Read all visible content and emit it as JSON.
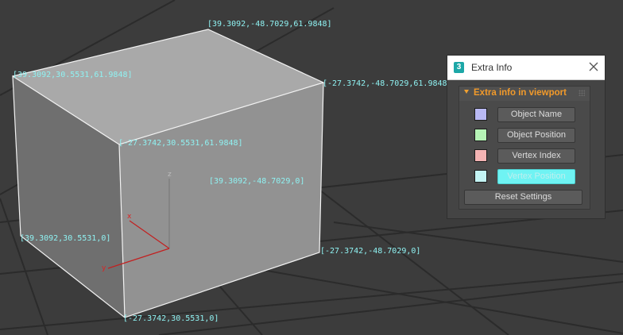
{
  "viewport": {
    "label_color": "#8ff2f2",
    "vertex_labels": [
      "[39.3092,-48.7029,61.9848]",
      "[39.3092,30.5531,61.9848]",
      "[-27.3742,-48.7029,61.9848]",
      "[-27.3742,30.5531,61.9848]",
      "[39.3092,-48.7029,0]",
      "[39.3092,30.5531,0]",
      "[-27.3742,-48.7029,0]",
      "[-27.3742,30.5531,0]"
    ],
    "axis_labels": {
      "z": "z",
      "x": "x",
      "y": "y"
    }
  },
  "panel": {
    "app_icon": "3",
    "title": "Extra Info",
    "close_icon": "close-icon",
    "rollout_title": "Extra info in viewport",
    "options": [
      {
        "label": "Object Name",
        "swatch": "#b9b9f4",
        "active": false
      },
      {
        "label": "Object Position",
        "swatch": "#b6f4b6",
        "active": false
      },
      {
        "label": "Vertex Index",
        "swatch": "#f4b4b4",
        "active": false
      },
      {
        "label": "Vertex Position",
        "swatch": "#c4f4f4",
        "active": true
      }
    ],
    "reset_label": "Reset Settings"
  }
}
